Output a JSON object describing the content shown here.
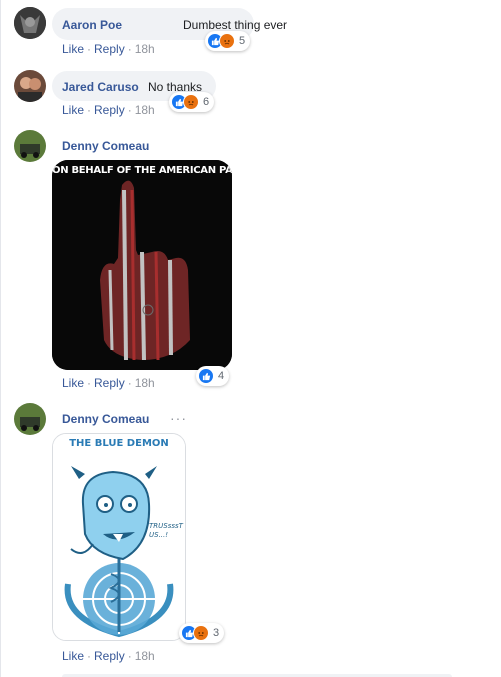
{
  "comments": [
    {
      "author": "Aaron Poe",
      "text": "Dumbest thing ever",
      "like": "Like",
      "reply": "Reply",
      "time": "18h",
      "reaction_count": "5"
    },
    {
      "author": "Jared Caruso",
      "text": "No thanks",
      "like": "Like",
      "reply": "Reply",
      "time": "18h",
      "reaction_count": "6"
    },
    {
      "author": "Denny Comeau",
      "image_caption": "ON BEHALF OF THE AMERICAN PATRIOTS",
      "like": "Like",
      "reply": "Reply",
      "time": "18h",
      "reaction_count": "4"
    },
    {
      "author": "Denny Comeau",
      "image_title": "THE BLUE DEMON",
      "image_speech": "TRUSsssT US...!",
      "like": "Like",
      "reply": "Reply",
      "time": "18h",
      "reaction_count": "3"
    }
  ],
  "colors": {
    "link": "#385898",
    "like_icon": "#1877f2",
    "angry_icon": "#e9710f",
    "bubble": "#f0f2f5"
  },
  "icons": [
    "like-reaction-icon",
    "angry-reaction-icon",
    "more-options-icon"
  ]
}
